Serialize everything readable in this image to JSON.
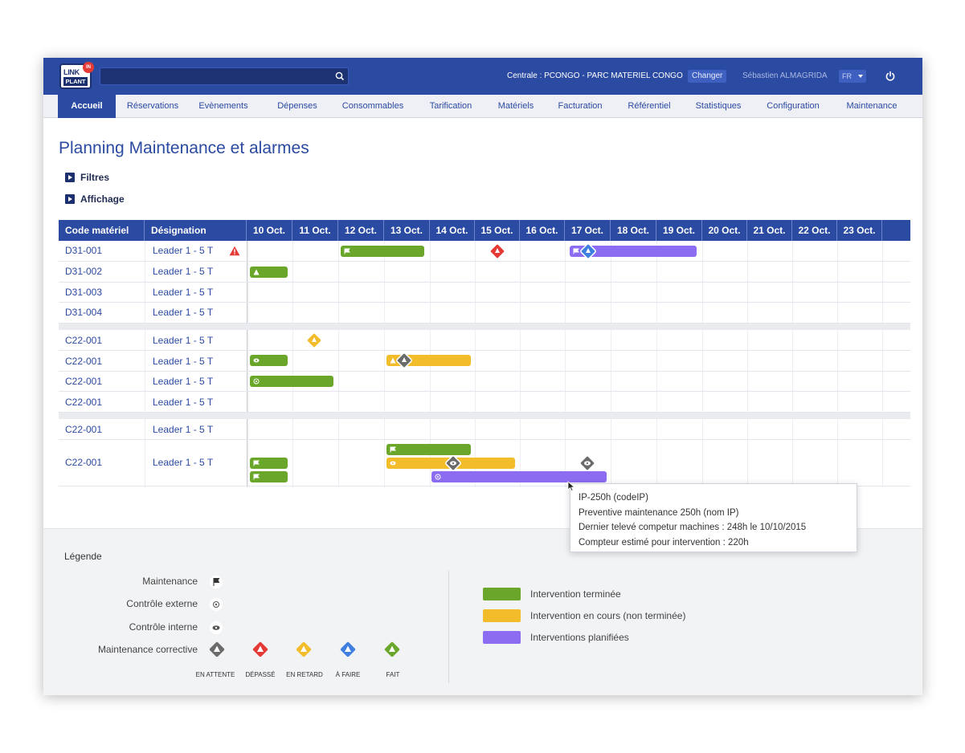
{
  "header": {
    "logo_top": "LINK",
    "logo_bottom": "PLANT",
    "logo_badge": "IN",
    "search_placeholder": "",
    "centrale": "Centrale : PCONGO - PARC MATERIEL CONGO",
    "changer_label": "Changer",
    "user": "Sébastien ALMAGRIDA",
    "lang": "FR"
  },
  "nav": {
    "tabs": [
      "Accueil",
      "Réservations",
      "Evènements",
      "Dépenses",
      "Consommables",
      "Tarification",
      "Matériels",
      "Facturation",
      "Référentiel",
      "Statistiques",
      "Configuration",
      "Maintenance"
    ],
    "active": "Accueil"
  },
  "page": {
    "title": "Planning Maintenance et alarmes",
    "filters_label": "Filtres",
    "display_label": "Affichage"
  },
  "grid": {
    "col_code": "Code matériel",
    "col_designation": "Désignation",
    "days": [
      "10 Oct.",
      "11 Oct.",
      "12 Oct.",
      "13 Oct.",
      "14 Oct.",
      "15 Oct.",
      "16 Oct.",
      "17 Oct.",
      "18 Oct.",
      "19 Oct.",
      "20 Oct.",
      "21 Oct.",
      "22 Oct.",
      "23 Oct."
    ],
    "rows": [
      {
        "code": "D31-001",
        "designation": "Leader 1 - 5 T",
        "alert": true
      },
      {
        "code": "D31-002",
        "designation": "Leader 1 - 5 T"
      },
      {
        "code": "D31-003",
        "designation": "Leader 1 - 5 T"
      },
      {
        "code": "D31-004",
        "designation": "Leader 1 - 5 T"
      },
      {
        "code": "C22-001",
        "designation": "Leader 1 - 5 T"
      },
      {
        "code": "C22-001",
        "designation": "Leader 1 - 5 T"
      },
      {
        "code": "C22-001",
        "designation": "Leader 1 - 5 T"
      },
      {
        "code": "C22-001",
        "designation": "Leader 1 - 5 T"
      },
      {
        "code": "C22-001",
        "designation": "Leader 1 - 5 T"
      },
      {
        "code": "C22-001",
        "designation": "Leader 1 - 5 T"
      }
    ]
  },
  "tooltip": {
    "line1": "IP-250h (codeIP)",
    "line2": "Preventive maintenance 250h (nom IP)",
    "line3": "Dernier televé competur machines : 248h le 10/10/2015",
    "line4": "Compteur estimé pour intervention : 220h"
  },
  "legend": {
    "title": "Légende",
    "maintenance": "Maintenance",
    "controle_externe": "Contrôle externe",
    "controle_interne": "Contrôle interne",
    "maintenance_corrective": "Maintenance corrective",
    "states": [
      "EN ATTENTE",
      "DÉPASSÉ",
      "EN RETARD",
      "À FAIRE",
      "FAIT"
    ],
    "state_colors": [
      "#6b6b6b",
      "#e53935",
      "#f2bc2b",
      "#3f7fe0",
      "#6aa62a"
    ],
    "done": "Intervention terminée",
    "in_progress": "Intervention en cours (non terminée)",
    "planned": "Interventions planifiées",
    "colors": {
      "green": "#6aa62a",
      "yellow": "#f2bc2b",
      "purple": "#8c6cf0"
    }
  }
}
